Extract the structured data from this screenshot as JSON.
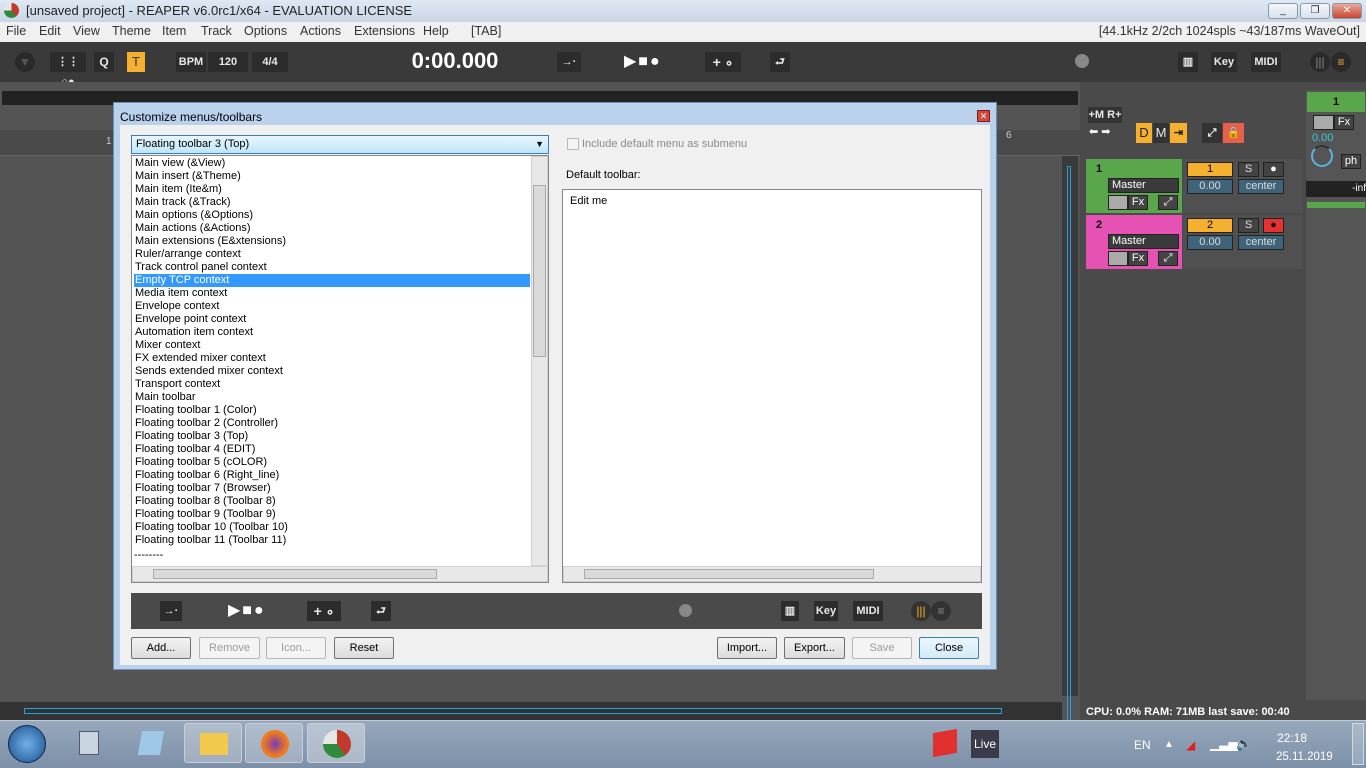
{
  "window": {
    "title": "[unsaved project] - REAPER v6.0rc1/x64 - EVALUATION LICENSE",
    "status": "[44.1kHz 2/2ch 1024spls ~43/187ms WaveOut]"
  },
  "menu": [
    "File",
    "Edit",
    "View",
    "Theme",
    "Item",
    "Track",
    "Options",
    "Actions",
    "Extensions",
    "Help",
    "[TAB]"
  ],
  "transport": {
    "q": "Q",
    "t": "T",
    "bpm_label": "BPM",
    "bpm": "120",
    "sig": "4/4",
    "time": "0:00.000",
    "key": "Key",
    "midi": "MIDI"
  },
  "ruler": {
    "marks": [
      "1",
      "6"
    ]
  },
  "dialog": {
    "title": "Customize menus/toolbars",
    "dropdown": "Floating toolbar 3 (Top)",
    "include_default": "Include default menu as submenu",
    "default_label": "Default toolbar:",
    "edit_item": "Edit me",
    "selected_index": 9,
    "items": [
      "Main view (&View)",
      "Main insert (&Theme)",
      "Main item (Ite&m)",
      "Main track (&Track)",
      "Main options (&Options)",
      "Main actions (&Actions)",
      "Main extensions (E&xtensions)",
      "Ruler/arrange context",
      "Track control panel context",
      "Empty TCP context",
      "Media item context",
      "Envelope context",
      "Envelope point context",
      "Automation item context",
      "Mixer context",
      "FX extended mixer context",
      "Sends extended mixer context",
      "Transport context",
      "Main toolbar",
      "Floating toolbar 1 (Color)",
      "Floating toolbar 2 (Controller)",
      "Floating toolbar 3 (Top)",
      "Floating toolbar 4 (EDIT)",
      "Floating toolbar 5 (cOLOR)",
      "Floating toolbar 6 (Right_line)",
      "Floating toolbar 7 (Browser)",
      "Floating toolbar 8 (Toolbar 8)",
      "Floating toolbar 9 (Toolbar 9)",
      "Floating toolbar 10 (Toolbar 10)",
      "Floating toolbar 11 (Toolbar 11)"
    ],
    "partial_item": "--------",
    "preview": {
      "key": "Key",
      "midi": "MIDI"
    },
    "buttons": {
      "add": "Add...",
      "remove": "Remove",
      "icon": "Icon...",
      "reset": "Reset",
      "import": "Import...",
      "export": "Export...",
      "save": "Save",
      "close": "Close"
    }
  },
  "mixer": {
    "m": "+M",
    "r": "R+",
    "d": "D",
    "mm": "M",
    "tracks": [
      {
        "num": "1",
        "name": "Master",
        "fx": "Fx",
        "rec": "1",
        "s": "S",
        "vol": "0.00",
        "pan": "center",
        "color": "#5aa64a"
      },
      {
        "num": "2",
        "name": "Master",
        "fx": "Fx",
        "rec": "2",
        "s": "S",
        "vol": "0.00",
        "pan": "center",
        "color": "#e652b4"
      }
    ],
    "strip": {
      "num": "1",
      "fx": "Fx",
      "vol": "0.00",
      "ph": "ph",
      "peak": "-inf"
    }
  },
  "status": "CPU: 0.0%  RAM: 71MB  last save: 00:40",
  "taskbar": {
    "live": "Live",
    "lang": "EN",
    "time": "22:18",
    "date": "25.11.2019"
  }
}
